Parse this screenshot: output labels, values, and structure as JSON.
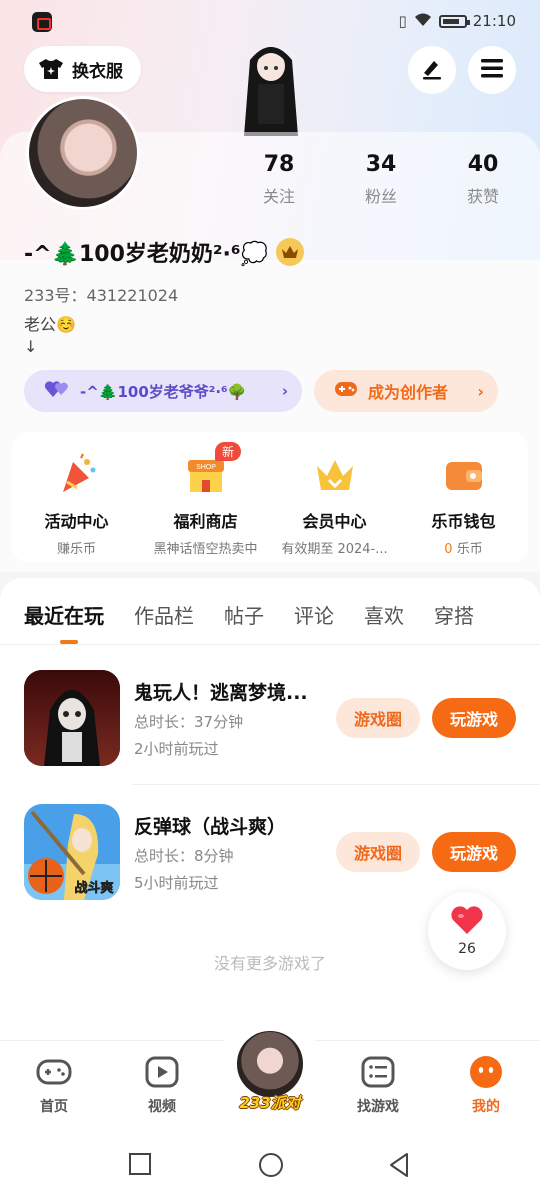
{
  "status_bar": {
    "time": "21:10"
  },
  "header": {
    "outfit_label": "换衣服"
  },
  "profile": {
    "stats": [
      {
        "value": "78",
        "label": "关注"
      },
      {
        "value": "34",
        "label": "粉丝"
      },
      {
        "value": "40",
        "label": "获赞"
      }
    ],
    "nickname": "-^🌲100岁老奶奶²·⁶💭",
    "uid": "233号：431221024",
    "bio_line1": "老公☺️",
    "bio_line2": "↓",
    "couple_name": "-^🌲100岁老爷爷²·⁶🌳",
    "creator_label": "成为创作者"
  },
  "features": [
    {
      "title": "活动中心",
      "sub": "赚乐币"
    },
    {
      "title": "福利商店",
      "sub": "黑神话悟空热卖中",
      "badge": "新",
      "icon_text": "SHOP"
    },
    {
      "title": "会员中心",
      "sub": "有效期至 2024-..."
    },
    {
      "title": "乐币钱包",
      "sub_value": "0",
      "sub_unit": " 乐币"
    }
  ],
  "tabs": [
    "最近在玩",
    "作品栏",
    "帖子",
    "评论",
    "喜欢",
    "穿搭"
  ],
  "games": [
    {
      "name": "鬼玩人！逃离梦境...",
      "duration": "总时长：37分钟",
      "last_played": "2小时前玩过",
      "circle_label": "游戏圈",
      "play_label": "玩游戏"
    },
    {
      "name": "反弹球（战斗爽）",
      "duration": "总时长：8分钟",
      "last_played": "5小时前玩过",
      "circle_label": "游戏圈",
      "play_label": "玩游戏",
      "thumb_text": "战斗爽"
    }
  ],
  "no_more_text": "没有更多游戏了",
  "like_count": "26",
  "bottom_nav": {
    "items": [
      {
        "label": "首页"
      },
      {
        "label": "视频"
      },
      {
        "label": "找游戏"
      },
      {
        "label": "我的"
      }
    ],
    "party_label": "233派对"
  },
  "colors": {
    "accent": "#f56a12",
    "purple": "#5b4bc8"
  }
}
